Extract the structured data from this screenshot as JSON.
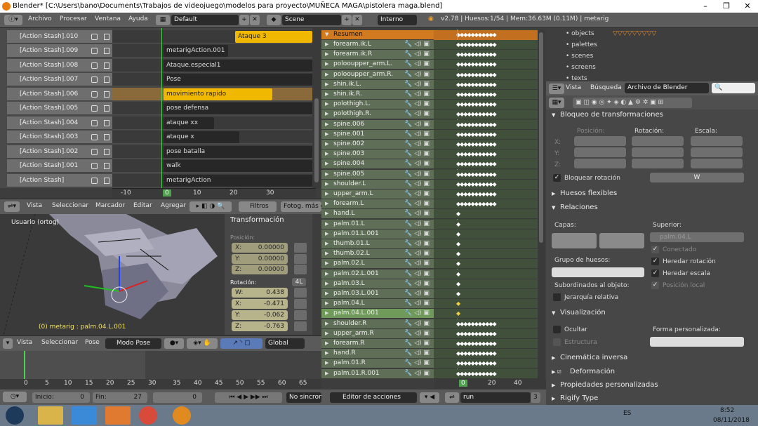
{
  "window": {
    "title": "Blender* [C:\\Users\\bano\\Documents\\Trabajos de videojuego\\modelos para proyecto\\MUÑECA MAGA\\pistolera maga.blend]"
  },
  "infobar": {
    "menus": [
      "Archivo",
      "Procesar",
      "Ventana",
      "Ayuda"
    ],
    "layout": "Default",
    "scene": "Scene",
    "engine": "Interno",
    "stats": "v2.78 | Huesos:1/54 | Mem:36.63M (0.11M) | metarig"
  },
  "nla": {
    "channels": [
      "[Action Stash].010",
      "[Action Stash].009",
      "[Action Stash].008",
      "[Action Stash].007",
      "[Action Stash].006",
      "[Action Stash].005",
      "[Action Stash].004",
      "[Action Stash].003",
      "[Action Stash].002",
      "[Action Stash].001",
      "[Action Stash]"
    ],
    "strips": [
      "Ataque 3",
      "metarigAction.001",
      "Ataque.especial1",
      "Pose",
      "movimiento rapido",
      "pose defensa",
      "ataque xx",
      "ataque x",
      "pose batalla",
      "walk",
      "metarigAction"
    ],
    "ruler": [
      "-10",
      "0",
      "10",
      "20",
      "30"
    ],
    "current_frame": "0",
    "header": [
      "Vista",
      "Seleccionar",
      "Marcador",
      "Editar",
      "Agregar"
    ],
    "filters": "Filtros",
    "fotog": "Fotog. más c"
  },
  "view3d": {
    "label": "Usuario (ortog)",
    "status": "(0) metarig : palm.04.L.001",
    "header": [
      "Vista",
      "Seleccionar",
      "Pose"
    ],
    "mode": "Modo Pose",
    "orientation": "Global"
  },
  "npanel": {
    "title": "Transformación",
    "pos_label": "Posición:",
    "pos": [
      {
        "l": "X:",
        "v": "0.00000"
      },
      {
        "l": "Y:",
        "v": "0.00000"
      },
      {
        "l": "Z:",
        "v": "0.00000"
      }
    ],
    "rot_label": "Rotación:",
    "rot_mode": "4L",
    "rot": [
      {
        "l": "W:",
        "v": "0.438"
      },
      {
        "l": "X:",
        "v": "-0.471"
      },
      {
        "l": "Y:",
        "v": "-0.062"
      },
      {
        "l": "Z:",
        "v": "-0.763"
      }
    ]
  },
  "timeline": {
    "ruler": [
      "0",
      "5",
      "10",
      "15",
      "20",
      "25",
      "30",
      "35",
      "40",
      "45",
      "50",
      "55",
      "60",
      "65"
    ],
    "start_label": "Inicio:",
    "start": "0",
    "end_label": "Fin:",
    "end": "27",
    "frame": "0",
    "sync": "No sincroniz"
  },
  "dopesheet": {
    "summary": "Resumen",
    "channels": [
      "forearm.ik.L",
      "forearm.ik.R",
      "polooupper_arm.L.",
      "polooupper_arm.R.",
      "shin.ik.L.",
      "shin.ik.R.",
      "polothigh.L.",
      "polothigh.R.",
      "spine.006",
      "spine.001",
      "spine.002",
      "spine.003",
      "spine.004",
      "spine.005",
      "shoulder.L",
      "upper_arm.L",
      "forearm.L",
      "hand.L",
      "palm.01.L",
      "palm.01.L.001",
      "thumb.01.L",
      "thumb.02.L",
      "palm.02.L",
      "palm.02.L.001",
      "palm.03.L",
      "palm.03.L.001",
      "palm.04.L",
      "palm.04.L.001",
      "shoulder.R",
      "upper_arm.R",
      "forearm.R",
      "hand.R",
      "palm.01.R",
      "palm.01.R.001"
    ],
    "ruler": [
      "0",
      "20",
      "40"
    ],
    "frame": "0",
    "editor": "Editor de acciones",
    "action": "run",
    "users": "3"
  },
  "outliner": {
    "items": [
      "objects",
      "palettes",
      "scenes",
      "screens",
      "texts"
    ]
  },
  "props": {
    "header": [
      "Vista",
      "Búsqueda"
    ],
    "display": "Archivo de Blender",
    "bloqueo_title": "Bloqueo de transformaciones",
    "pos_col": "Posición:",
    "rot_col": "Rotación:",
    "scale_col": "Escala:",
    "axes": [
      "X:",
      "Y:",
      "Z:"
    ],
    "lock_rot": "Bloquear rotación",
    "lock_rot_mode": "W",
    "flex": "Huesos flexibles",
    "rel": "Relaciones",
    "capas": "Capas:",
    "superior": "Superior:",
    "parent": "palm.04.L",
    "conectado": "Conectado",
    "grupo": "Grupo de huesos:",
    "her_rot": "Heredar rotación",
    "her_esc": "Heredar escala",
    "sub_obj": "Subordinados al objeto:",
    "pos_local": "Posición local",
    "jerarquia": "Jerarquía relativa",
    "vis": "Visualización",
    "ocultar": "Ocultar",
    "forma": "Forma personalizada:",
    "estructura": "Estructura",
    "cinematica": "Cinemática inversa",
    "deformacion": "Deformación",
    "prop_pers": "Propiedades personalizadas",
    "rigify": "Rigify Type"
  },
  "taskbar": {
    "lang": "ES",
    "time": "8:52",
    "date": "08/11/2018"
  }
}
